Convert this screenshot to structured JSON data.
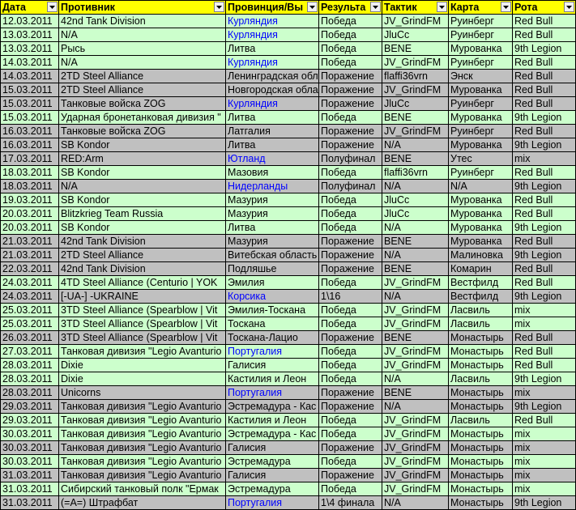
{
  "colors": {
    "header_bg": "#ffff00",
    "win_row": "#ccffcc",
    "loss_row": "#c0c0c0",
    "province_link": "#0000ff"
  },
  "headers": [
    "Дата",
    "Противник",
    "Провинция/Вы",
    "Результа",
    "Тактик",
    "Карта",
    "Рота"
  ],
  "rows": [
    {
      "date": "12.03.2011",
      "opponent": "42nd Tank Division",
      "province": "Курляндия",
      "province_link": true,
      "result": "Победа",
      "tactic": "JV_GrindFM",
      "map": "Руинберг",
      "company": "Red Bull",
      "kind": "win"
    },
    {
      "date": "13.03.2011",
      "opponent": "N/A",
      "province": "Курляндия",
      "province_link": true,
      "result": "Победа",
      "tactic": "JluCc",
      "map": "Руинберг",
      "company": "Red Bull",
      "kind": "win"
    },
    {
      "date": "13.03.2011",
      "opponent": "Рысь",
      "province": "Литва",
      "province_link": false,
      "result": "Победа",
      "tactic": "BENE",
      "map": "Мурованка",
      "company": "9th Legion",
      "kind": "win"
    },
    {
      "date": "14.03.2011",
      "opponent": "N/A",
      "province": "Курляндия",
      "province_link": true,
      "result": "Победа",
      "tactic": "JV_GrindFM",
      "map": "Руинберг",
      "company": "Red Bull",
      "kind": "win"
    },
    {
      "date": "14.03.2011",
      "opponent": "2TD Steel Alliance",
      "province": "Ленинградская обл",
      "province_link": false,
      "result": "Поражение",
      "tactic": "flaffi36vrn",
      "map": "Энск",
      "company": "Red Bull",
      "kind": "loss"
    },
    {
      "date": "15.03.2011",
      "opponent": "2TD Steel Alliance",
      "province": "Новгородская обла",
      "province_link": false,
      "result": "Поражение",
      "tactic": "JV_GrindFM",
      "map": "Мурованка",
      "company": "Red Bull",
      "kind": "loss"
    },
    {
      "date": "15.03.2011",
      "opponent": "Танковые войска ZOG",
      "province": "Курляндия",
      "province_link": true,
      "result": "Поражение",
      "tactic": "JluCc",
      "map": "Руинберг",
      "company": "Red Bull",
      "kind": "loss"
    },
    {
      "date": "15.03.2011",
      "opponent": "Ударная бронетанковая дивизия \"",
      "province": "Литва",
      "province_link": false,
      "result": "Победа",
      "tactic": "BENE",
      "map": "Мурованка",
      "company": "9th Legion",
      "kind": "win"
    },
    {
      "date": "16.03.2011",
      "opponent": "Танковые войска ZOG",
      "province": "Латгалия",
      "province_link": false,
      "result": "Поражение",
      "tactic": "JV_GrindFM",
      "map": "Руинберг",
      "company": "Red Bull",
      "kind": "loss"
    },
    {
      "date": "16.03.2011",
      "opponent": "SB Kondor",
      "province": "Литва",
      "province_link": false,
      "result": "Поражение",
      "tactic": "N/A",
      "map": "Мурованка",
      "company": "9th Legion",
      "kind": "loss"
    },
    {
      "date": "17.03.2011",
      "opponent": "RED:Arm",
      "province": "Ютланд",
      "province_link": true,
      "result": "Полуфинал",
      "tactic": "BENE",
      "map": "Утес",
      "company": "mix",
      "kind": "semi"
    },
    {
      "date": "18.03.2011",
      "opponent": "SB Kondor",
      "province": "Мазовия",
      "province_link": false,
      "result": "Победа",
      "tactic": "flaffi36vrn",
      "map": "Руинберг",
      "company": "Red Bull",
      "kind": "win"
    },
    {
      "date": "18.03.2011",
      "opponent": "N/A",
      "province": "Нидерланды",
      "province_link": true,
      "result": "Полуфинал",
      "tactic": "N/A",
      "map": "N/A",
      "company": "9th Legion",
      "kind": "semi"
    },
    {
      "date": "19.03.2011",
      "opponent": "SB Kondor",
      "province": "Мазурия",
      "province_link": false,
      "result": "Победа",
      "tactic": "JluCc",
      "map": "Мурованка",
      "company": "Red Bull",
      "kind": "win"
    },
    {
      "date": "20.03.2011",
      "opponent": "Blitzkrieg Team Russia",
      "province": "Мазурия",
      "province_link": false,
      "result": "Победа",
      "tactic": "JluCc",
      "map": "Мурованка",
      "company": "Red Bull",
      "kind": "win"
    },
    {
      "date": "20.03.2011",
      "opponent": "SB Kondor",
      "province": "Литва",
      "province_link": false,
      "result": "Победа",
      "tactic": "N/A",
      "map": "Мурованка",
      "company": "9th Legion",
      "kind": "win"
    },
    {
      "date": "21.03.2011",
      "opponent": "42nd Tank Division",
      "province": "Мазурия",
      "province_link": false,
      "result": "Поражение",
      "tactic": "BENE",
      "map": "Мурованка",
      "company": "Red Bull",
      "kind": "loss"
    },
    {
      "date": "21.03.2011",
      "opponent": "2TD Steel Alliance",
      "province": "Витебская область",
      "province_link": false,
      "result": "Поражение",
      "tactic": "N/A",
      "map": "Малиновка",
      "company": "9th Legion",
      "kind": "loss"
    },
    {
      "date": "22.03.2011",
      "opponent": "42nd Tank Division",
      "province": "Подляшье",
      "province_link": false,
      "result": "Поражение",
      "tactic": "BENE",
      "map": "Комарин",
      "company": "Red Bull",
      "kind": "loss"
    },
    {
      "date": "24.03.2011",
      "opponent": "4TD Steel Alliance (Centurio | YOK",
      "province": "Эмилия",
      "province_link": false,
      "result": "Победа",
      "tactic": "JV_GrindFM",
      "map": "Вестфилд",
      "company": "Red Bull",
      "kind": "win"
    },
    {
      "date": "24.03.2011",
      "opponent": "[-UA-] -UKRAINE",
      "province": "Корсика",
      "province_link": true,
      "result": "1\\16",
      "tactic": "N/A",
      "map": "Вестфилд",
      "company": "9th Legion",
      "kind": "semi"
    },
    {
      "date": "25.03.2011",
      "opponent": "3TD Steel Alliance (Spearblow | Vit",
      "province": "Эмилия-Тоскана",
      "province_link": false,
      "result": "Победа",
      "tactic": "JV_GrindFM",
      "map": "Ласвиль",
      "company": "mix",
      "kind": "win"
    },
    {
      "date": "25.03.2011",
      "opponent": "3TD Steel Alliance (Spearblow | Vit",
      "province": "Тоскана",
      "province_link": false,
      "result": "Победа",
      "tactic": "JV_GrindFM",
      "map": "Ласвиль",
      "company": "mix",
      "kind": "win"
    },
    {
      "date": "26.03.2011",
      "opponent": "3TD Steel Alliance (Spearblow | Vit",
      "province": "Тоскана-Лацио",
      "province_link": false,
      "result": "Поражение",
      "tactic": "BENE",
      "map": "Монастырь",
      "company": "Red Bull",
      "kind": "loss"
    },
    {
      "date": "27.03.2011",
      "opponent": "Танковая дивизия \"Legio Avanturio",
      "province": "Португалия",
      "province_link": true,
      "result": "Победа",
      "tactic": "JV_GrindFM",
      "map": "Монастырь",
      "company": "Red Bull",
      "kind": "win"
    },
    {
      "date": "28.03.2011",
      "opponent": "Dixie",
      "province": "Галисия",
      "province_link": false,
      "result": "Победа",
      "tactic": "JV_GrindFM",
      "map": "Монастырь",
      "company": "Red Bull",
      "kind": "win"
    },
    {
      "date": "28.03.2011",
      "opponent": "Dixie",
      "province": "Кастилия и Леон",
      "province_link": false,
      "result": "Победа",
      "tactic": "N/A",
      "map": "Ласвиль",
      "company": "9th Legion",
      "kind": "win"
    },
    {
      "date": "28.03.2011",
      "opponent": "Unicorns",
      "province": "Португалия",
      "province_link": true,
      "result": "Поражение",
      "tactic": "BENE",
      "map": "Монастырь",
      "company": "mix",
      "kind": "loss"
    },
    {
      "date": "29.03.2011",
      "opponent": "Танковая дивизия \"Legio Avanturio",
      "province": "Эстремадура - Кас",
      "province_link": false,
      "result": "Поражение",
      "tactic": "N/A",
      "map": "Монастырь",
      "company": "9th Legion",
      "kind": "loss"
    },
    {
      "date": "29.03.2011",
      "opponent": "Танковая дивизия \"Legio Avanturio",
      "province": "Кастилия и Леон",
      "province_link": false,
      "result": "Победа",
      "tactic": "JV_GrindFM",
      "map": "Ласвиль",
      "company": "Red Bull",
      "kind": "win"
    },
    {
      "date": "30.03.2011",
      "opponent": "Танковая дивизия \"Legio Avanturio",
      "province": "Эстремадура - Кас",
      "province_link": false,
      "result": "Победа",
      "tactic": "JV_GrindFM",
      "map": "Монастырь",
      "company": "mix",
      "kind": "win"
    },
    {
      "date": "30.03.2011",
      "opponent": "Танковая дивизия \"Legio Avanturio",
      "province": "Галисия",
      "province_link": false,
      "result": "Поражение",
      "tactic": "JV_GrindFM",
      "map": "Монастырь",
      "company": "mix",
      "kind": "loss"
    },
    {
      "date": "30.03.2011",
      "opponent": "Танковая дивизия \"Legio Avanturio",
      "province": "Эстремадура",
      "province_link": false,
      "result": "Победа",
      "tactic": "JV_GrindFM",
      "map": "Монастырь",
      "company": "mix",
      "kind": "win"
    },
    {
      "date": "31.03.2011",
      "opponent": "Танковая дивизия \"Legio Avanturio",
      "province": "Галисия",
      "province_link": false,
      "result": "Поражение",
      "tactic": "JV_GrindFM",
      "map": "Монастырь",
      "company": "mix",
      "kind": "loss"
    },
    {
      "date": "31.03.2011",
      "opponent": "Сибирский танковый полк \"Ермак",
      "province": "Эстремадура",
      "province_link": false,
      "result": "Победа",
      "tactic": "JV_GrindFM",
      "map": "Монастырь",
      "company": "mix",
      "kind": "win"
    },
    {
      "date": "31.03.2011",
      "opponent": "(=A=) Штрафбат",
      "province": "Португалия",
      "province_link": true,
      "result": "1\\4 финала",
      "tactic": "N/A",
      "map": "Монастырь",
      "company": "9th Legion",
      "kind": "semi"
    }
  ]
}
